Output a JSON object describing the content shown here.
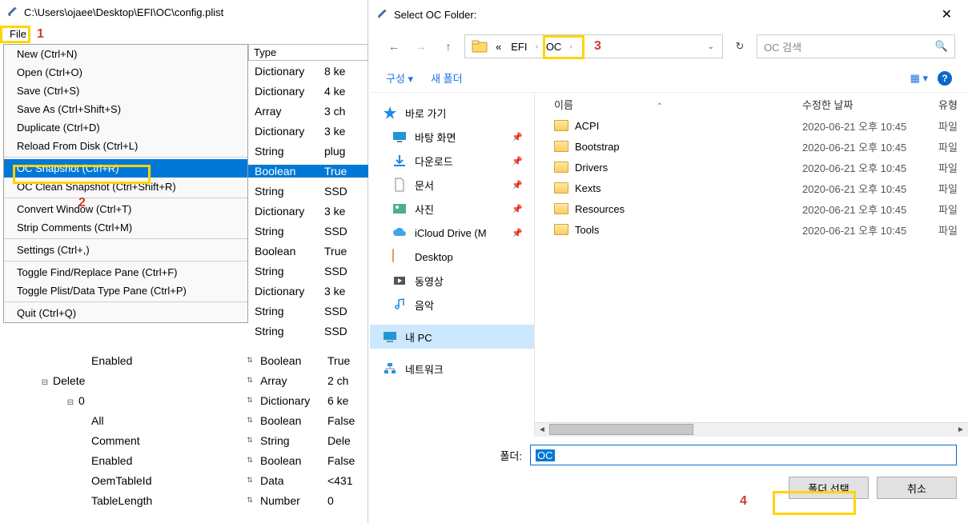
{
  "editor": {
    "title_path": "C:\\Users\\ojaee\\Desktop\\EFI\\OC\\config.plist",
    "file_menu_label": "File",
    "menu": {
      "items": [
        "New (Ctrl+N)",
        "Open (Ctrl+O)",
        "Save (Ctrl+S)",
        "Save As (Ctrl+Shift+S)",
        "Duplicate (Ctrl+D)",
        "Reload From Disk (Ctrl+L)"
      ],
      "snapshot": "OC Snapshot (Ctrl+R)",
      "clean_snapshot": "OC Clean Snapshot (Ctrl+Shift+R)",
      "items2": [
        "Convert Window (Ctrl+T)",
        "Strip Comments (Ctrl+M)"
      ],
      "settings": "Settings (Ctrl+,)",
      "items3": [
        "Toggle Find/Replace Pane (Ctrl+F)",
        "Toggle Plist/Data Type Pane (Ctrl+P)"
      ],
      "quit": "Quit (Ctrl+Q)"
    },
    "type_header": "Type",
    "type_rows": [
      {
        "type": "Dictionary",
        "val": "8 ke"
      },
      {
        "type": "Dictionary",
        "val": "4 ke"
      },
      {
        "type": "Array",
        "val": "3 ch"
      },
      {
        "type": "Dictionary",
        "val": "3 ke"
      },
      {
        "type": "String",
        "val": "plug"
      },
      {
        "type": "Boolean",
        "val": "True",
        "selected": true
      },
      {
        "type": "String",
        "val": "SSD"
      },
      {
        "type": "Dictionary",
        "val": "3 ke"
      },
      {
        "type": "String",
        "val": "SSD"
      },
      {
        "type": "Boolean",
        "val": "True"
      },
      {
        "type": "String",
        "val": "SSD"
      },
      {
        "type": "Dictionary",
        "val": "3 ke"
      },
      {
        "type": "String",
        "val": "SSD"
      },
      {
        "type": "String",
        "val": "SSD"
      }
    ],
    "lower_tree": [
      {
        "key": "Enabled",
        "ind": "ind3",
        "type": "Boolean",
        "val": "True"
      },
      {
        "key": "Delete",
        "ind": "ind1",
        "type": "Array",
        "val": "2 ch",
        "exp": "⊟"
      },
      {
        "key": "0",
        "ind": "ind2",
        "type": "Dictionary",
        "val": "6 ke",
        "exp": "⊟"
      },
      {
        "key": "All",
        "ind": "ind3",
        "type": "Boolean",
        "val": "False"
      },
      {
        "key": "Comment",
        "ind": "ind3",
        "type": "String",
        "val": "Dele"
      },
      {
        "key": "Enabled",
        "ind": "ind3",
        "type": "Boolean",
        "val": "False"
      },
      {
        "key": "OemTableId",
        "ind": "ind3",
        "type": "Data",
        "val": "<431"
      },
      {
        "key": "TableLength",
        "ind": "ind3",
        "type": "Number",
        "val": "0"
      }
    ]
  },
  "dialog": {
    "title": "Select OC Folder:",
    "crumbs": {
      "chev": "«",
      "part1": "EFI",
      "part2": "OC"
    },
    "search_placeholder": "OC 검색",
    "organize": "구성 ▾",
    "new_folder": "새 폴더",
    "side": {
      "quick": "바로 가기",
      "desktop": "바탕 화면",
      "downloads": "다운로드",
      "documents": "문서",
      "pictures": "사진",
      "icloud": "iCloud Drive (M",
      "desktop2": "Desktop",
      "videos": "동영상",
      "music": "음악",
      "thispc": "내 PC",
      "network": "네트워크"
    },
    "header": {
      "name": "이름",
      "date": "수정한 날짜",
      "type": "유형"
    },
    "files": [
      {
        "name": "ACPI",
        "date": "2020-06-21 오후 10:45",
        "type": "파일"
      },
      {
        "name": "Bootstrap",
        "date": "2020-06-21 오후 10:45",
        "type": "파일"
      },
      {
        "name": "Drivers",
        "date": "2020-06-21 오후 10:45",
        "type": "파일"
      },
      {
        "name": "Kexts",
        "date": "2020-06-21 오후 10:45",
        "type": "파일"
      },
      {
        "name": "Resources",
        "date": "2020-06-21 오후 10:45",
        "type": "파일"
      },
      {
        "name": "Tools",
        "date": "2020-06-21 오후 10:45",
        "type": "파일"
      }
    ],
    "folder_label": "폴더:",
    "folder_value": "OC",
    "select_btn": "폴더 선택",
    "cancel_btn": "취소"
  },
  "annotations": {
    "n1": "1",
    "n2": "2",
    "n3": "3",
    "n4": "4"
  }
}
